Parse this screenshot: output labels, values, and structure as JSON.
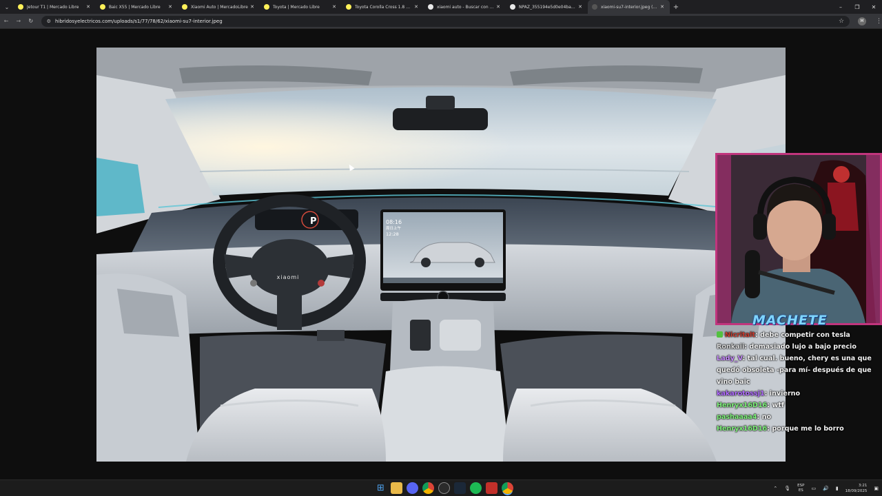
{
  "browser": {
    "tabs": [
      {
        "title": "Jetour T1 | Mercado Libre",
        "favicon_color": "#fff159",
        "active": false
      },
      {
        "title": "Baic X55 | Mercado Libre",
        "favicon_color": "#fff159",
        "active": false
      },
      {
        "title": "Xiaomi Auto | MercadoLibre",
        "favicon_color": "#fff159",
        "active": false
      },
      {
        "title": "Toyota | Mercado Libre",
        "favicon_color": "#fff159",
        "active": false
      },
      {
        "title": "Toyota Corolla Cross 1.8 Hev Se",
        "favicon_color": "#fff159",
        "active": false
      },
      {
        "title": "xiaomi auto - Buscar con Google",
        "favicon_color": "#e8e8e8",
        "active": false
      },
      {
        "title": "NPAZ_355194e5d0e04bae9f0a",
        "favicon_color": "#e8e8e8",
        "active": false
      },
      {
        "title": "xiaomi-su7-interior.jpeg (2000×",
        "favicon_color": "#555555",
        "active": true
      }
    ],
    "url": "hibridosyelectricos.com/uploads/s1/77/78/62/xiaomi-su7-interior.jpeg",
    "profile_initial": "M"
  },
  "car_screen": {
    "time": "08:16",
    "subtitle": "周日上午",
    "time2": "12:28",
    "gear": "P",
    "brand": "xiaomi"
  },
  "overlay": {
    "streamer_name": "MACHETE",
    "chat": [
      {
        "user": "Nicritalt",
        "user_color": "#c83b2e",
        "badge": true,
        "message": ": debe competir con tesla"
      },
      {
        "user": "Ronkaii",
        "user_color": "#d6d6d6",
        "badge": false,
        "message": ": demasiado lujo a bajo precio"
      },
      {
        "user": "Lady_V",
        "user_color": "#c98aff",
        "badge": false,
        "message": ": tal cual. bueno, chery es una que quedó obsoleta -para mí- después de que vino baic"
      },
      {
        "user": "kakarotossj1",
        "user_color": "#b06bff",
        "badge": false,
        "message": ": invierno"
      },
      {
        "user": "Henryx16D16",
        "user_color": "#7ef07a",
        "badge": false,
        "message": ": wtf"
      },
      {
        "user": "pashaaaa4",
        "user_color": "#7ef07a",
        "badge": false,
        "message": ": no"
      },
      {
        "user": "Henryx16D16",
        "user_color": "#7ef07a",
        "badge": false,
        "message": ": porque me lo borro"
      }
    ]
  },
  "taskbar": {
    "lang_top": "ESP",
    "lang_bottom": "ES",
    "time": "3:21",
    "date": "18/09/2025",
    "apps": [
      "windows-start",
      "file-explorer",
      "discord",
      "chrome",
      "obs",
      "steam",
      "spotify",
      "news",
      "chrome-2"
    ]
  }
}
